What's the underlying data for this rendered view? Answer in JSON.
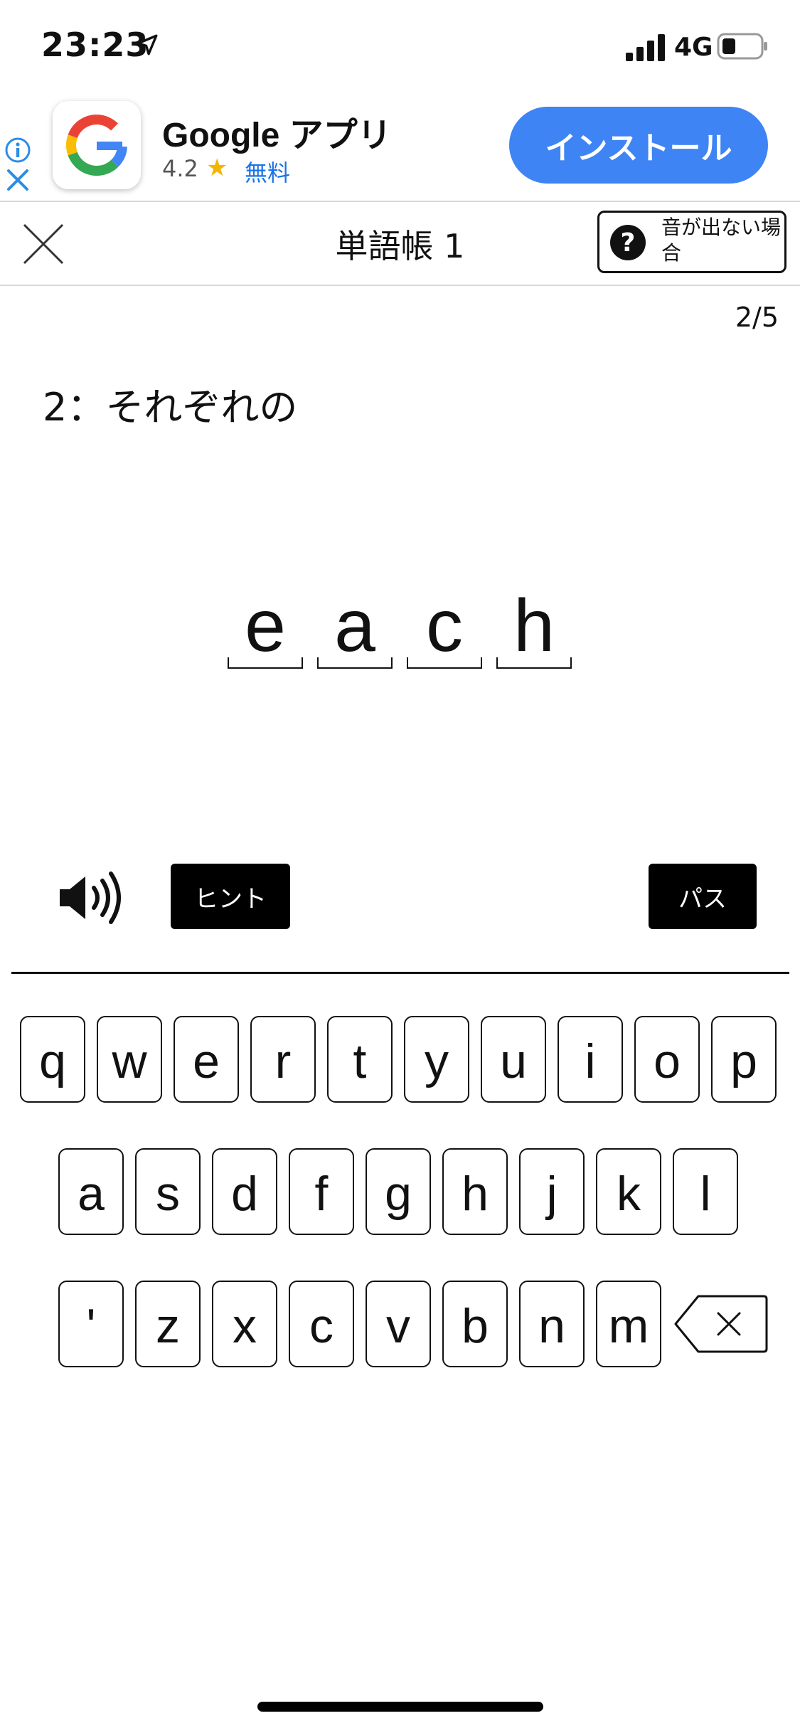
{
  "status_bar": {
    "time": "23:23",
    "network": "4G"
  },
  "ad": {
    "app_name": "Google アプリ",
    "rating": "4.2",
    "price": "無料",
    "install_label": "インストール"
  },
  "header": {
    "title": "単語帳 1",
    "help_label": "音が出ない場合"
  },
  "quiz": {
    "progress": "2/5",
    "question": "2：それぞれの",
    "answer_letters": [
      "e",
      "a",
      "c",
      "h"
    ]
  },
  "controls": {
    "hint_label": "ヒント",
    "pass_label": "パス"
  },
  "keyboard": {
    "rows": [
      [
        "q",
        "w",
        "e",
        "r",
        "t",
        "y",
        "u",
        "i",
        "o",
        "p"
      ],
      [
        "a",
        "s",
        "d",
        "f",
        "g",
        "h",
        "j",
        "k",
        "l"
      ],
      [
        "'",
        "z",
        "x",
        "c",
        "v",
        "b",
        "n",
        "m"
      ]
    ]
  },
  "colors": {
    "install_button": "#3f84f4",
    "rating_star": "#f5b400",
    "link_blue": "#1a73e8"
  }
}
